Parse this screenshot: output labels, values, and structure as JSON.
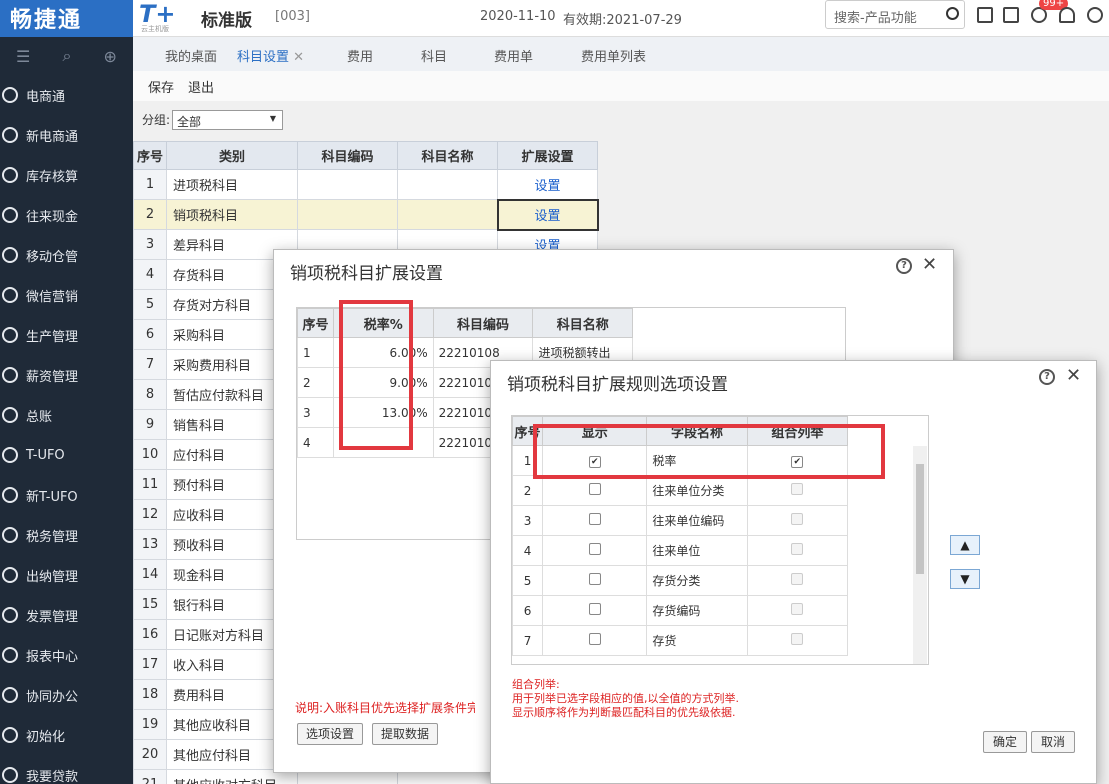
{
  "app": {
    "brand": "畅捷通",
    "logo": "T+",
    "logo_sub": "云主机版",
    "edition": "标准版",
    "company": "[003]",
    "date": "2020-11-10",
    "validity": "有效期:2021-07-29",
    "search_placeholder": "搜索-产品功能",
    "badge": "99+"
  },
  "sidebar": {
    "items": [
      "电商通",
      "新电商通",
      "库存核算",
      "往来现金",
      "移动仓管",
      "微信营销",
      "生产管理",
      "薪资管理",
      "总账",
      "T-UFO",
      "新T-UFO",
      "税务管理",
      "出纳管理",
      "发票管理",
      "报表中心",
      "协同办公",
      "初始化",
      "我要贷款"
    ]
  },
  "tabs": [
    "我的桌面",
    "科目设置",
    "费用",
    "科目",
    "费用单",
    "费用单列表"
  ],
  "tab_close": "✕",
  "toolbar": {
    "save": "保存",
    "exit": "退出"
  },
  "filter": {
    "label": "分组:",
    "value": "全部"
  },
  "main_table": {
    "headers": [
      "序号",
      "类别",
      "科目编码",
      "科目名称",
      "扩展设置"
    ],
    "rows": [
      [
        "1",
        "进项税科目",
        "",
        "",
        "设置"
      ],
      [
        "2",
        "销项税科目",
        "",
        "",
        "设置"
      ],
      [
        "3",
        "差异科目",
        "",
        "",
        "设置"
      ],
      [
        "4",
        "存货科目",
        "",
        "",
        ""
      ],
      [
        "5",
        "存货对方科目",
        "",
        "",
        ""
      ],
      [
        "6",
        "采购科目",
        "",
        "",
        ""
      ],
      [
        "7",
        "采购费用科目",
        "",
        "",
        ""
      ],
      [
        "8",
        "暂估应付款科目",
        "",
        "",
        ""
      ],
      [
        "9",
        "销售科目",
        "",
        "",
        ""
      ],
      [
        "10",
        "应付科目",
        "",
        "",
        ""
      ],
      [
        "11",
        "预付科目",
        "",
        "",
        ""
      ],
      [
        "12",
        "应收科目",
        "",
        "",
        ""
      ],
      [
        "13",
        "预收科目",
        "",
        "",
        ""
      ],
      [
        "14",
        "现金科目",
        "",
        "",
        ""
      ],
      [
        "15",
        "银行科目",
        "",
        "",
        ""
      ],
      [
        "16",
        "日记账对方科目",
        "",
        "",
        ""
      ],
      [
        "17",
        "收入科目",
        "",
        "",
        ""
      ],
      [
        "18",
        "费用科目",
        "",
        "",
        ""
      ],
      [
        "19",
        "其他应收科目",
        "",
        "",
        ""
      ],
      [
        "20",
        "其他应付科目",
        "",
        "",
        ""
      ],
      [
        "21",
        "其他应收对方科目",
        "",
        "",
        ""
      ]
    ]
  },
  "dialog1": {
    "title": "销项税科目扩展设置",
    "headers": [
      "序号",
      "税率%",
      "科目编码",
      "科目名称"
    ],
    "rows": [
      [
        "1",
        "6.00%",
        "22210108",
        "进项税额转出"
      ],
      [
        "2",
        "9.00%",
        "22210107",
        ""
      ],
      [
        "3",
        "13.00%",
        "22210106",
        ""
      ],
      [
        "4",
        "",
        "22210109",
        ""
      ]
    ],
    "note": "说明:入账科目优先选择扩展条件完全",
    "btn_options": "选项设置",
    "btn_fetch": "提取数据"
  },
  "dialog2": {
    "title": "销项税科目扩展规则选项设置",
    "headers": [
      "序号",
      "显示",
      "字段名称",
      "组合列举"
    ],
    "rows": [
      [
        "1",
        true,
        "税率",
        true
      ],
      [
        "2",
        false,
        "往来单位分类",
        false
      ],
      [
        "3",
        false,
        "往来单位编码",
        false
      ],
      [
        "4",
        false,
        "往来单位",
        false
      ],
      [
        "5",
        false,
        "存货分类",
        false
      ],
      [
        "6",
        false,
        "存货编码",
        false
      ],
      [
        "7",
        false,
        "存货",
        false
      ]
    ],
    "note_title": "组合列举:",
    "note_line1": "用于列举已选字段相应的值,以全值的方式列举.",
    "note_line2": "显示顺序将作为判断最匹配科目的优先级依据.",
    "ok": "确定",
    "cancel": "取消",
    "up": "▲",
    "down": "▼"
  }
}
